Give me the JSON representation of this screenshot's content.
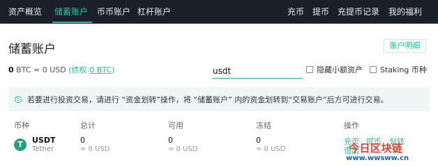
{
  "nav": {
    "left": [
      {
        "label": "资产概览",
        "active": false
      },
      {
        "label": "储蓄账户",
        "active": true
      },
      {
        "label": "币币账户",
        "active": false
      },
      {
        "label": "杠杆账户",
        "active": false
      }
    ],
    "right": [
      {
        "label": "充币"
      },
      {
        "label": "提币"
      },
      {
        "label": "充提币记录"
      },
      {
        "label": "我的福利"
      }
    ]
  },
  "page": {
    "title": "储蓄账户",
    "detail_button": "账户明细"
  },
  "summary": {
    "btc_value": "0",
    "btc_unit": "BTC",
    "approx": "≈",
    "usd_value": "0",
    "usd_unit": "USD",
    "pledge_prefix": "(债权:",
    "pledge_value": "0 BTC",
    "pledge_suffix": ")"
  },
  "search": {
    "value": "usdt"
  },
  "filters": {
    "hide_small": "隐藏小额资产",
    "staking": "Staking 币种"
  },
  "notice": {
    "icon": "info-icon",
    "text": "若要进行投资交易，请进行 “资金划转”操作，将 “储蓄账户” 内的资金划转到“交易账户”后方可进行交易。"
  },
  "table": {
    "headers": {
      "coin": "币种",
      "total": "总计",
      "available": "可用",
      "frozen": "冻结",
      "actions": "操作"
    },
    "rows": [
      {
        "logo_letter": "T",
        "symbol": "USDT",
        "name": "Tether",
        "total": "0",
        "total_usd": "≈ 0 USD",
        "available": "0",
        "available_usd": "≈ 0 USD",
        "frozen": "0",
        "frozen_usd": "≈ 0 USD",
        "actions": {
          "deposit": "充币",
          "withdraw": "提币",
          "transfer": "划转",
          "borrow": "借出"
        }
      }
    ]
  },
  "watermark": {
    "title": "今日区块链",
    "url": "www.wwsww.cn"
  },
  "colors": {
    "accent": "#2bbd9c",
    "nav_bg": "#1b1f2a",
    "notice_bg": "#eef7f5",
    "tether": "#26a17b"
  }
}
